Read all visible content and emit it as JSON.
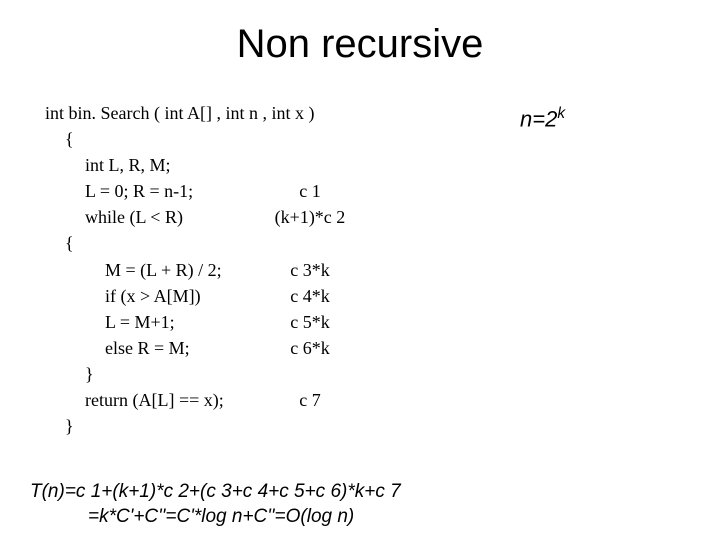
{
  "title": "Non recursive",
  "note_prefix": "n=2",
  "note_sup": "k",
  "code": {
    "sig": "int bin. Search ( int A[] , int n , int x )",
    "brace_open": "{",
    "decl": "int L, R, M;",
    "init": "L = 0; R = n-1;",
    "init_cost": "c 1",
    "while": "while (L < R)",
    "while_cost": "(k+1)*c 2",
    "brace_open_inner": "{",
    "m_assign": "M = (L + R) / 2;",
    "m_assign_cost": "c 3*k",
    "if": "if (x > A[M])",
    "if_cost": "c 4*k",
    "l_assign": " L = M+1;",
    "l_assign_cost": "c 5*k",
    "else": "else R = M;",
    "else_cost": "c 6*k",
    "brace_close_inner": "}",
    "return": "return (A[L] == x);",
    "return_cost": "c 7",
    "brace_close": "}"
  },
  "formula_line1": "T(n)=c 1+(k+1)*c 2+(c 3+c 4+c 5+c 6)*k+c 7",
  "formula_line2": "=k*C'+C''=C'*log n+C''=O(log n)"
}
